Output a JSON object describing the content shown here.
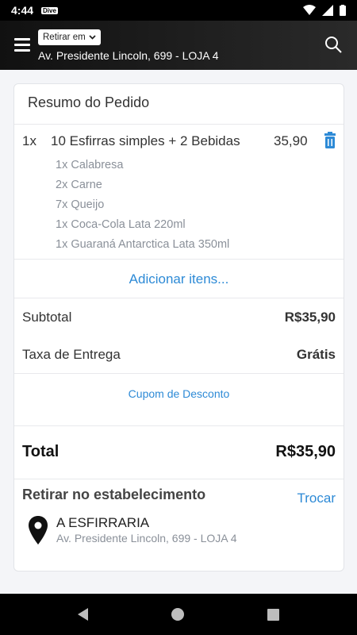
{
  "status_bar": {
    "time": "4:44",
    "app_badge": "Dive"
  },
  "header": {
    "pickup_mode": "Retirar em",
    "address": "Av. Presidente Lincoln, 699 - LOJA 4",
    "icons": {
      "menu": "menu-icon",
      "search": "search-icon"
    }
  },
  "summary": {
    "title": "Resumo do Pedido",
    "item": {
      "qty": "1x",
      "name": "10 Esfirras simples + 2 Bebidas",
      "price": "35,90",
      "sub_items": [
        "1x Calabresa",
        "2x Carne",
        "7x Queijo",
        "1x Coca-Cola Lata 220ml",
        "1x Guaraná Antarctica Lata 350ml"
      ]
    },
    "add_items": "Adicionar itens...",
    "subtotal_label": "Subtotal",
    "subtotal_value": "R$35,90",
    "delivery_label": "Taxa de Entrega",
    "delivery_value": "Grátis",
    "coupon": "Cupom de Desconto",
    "total_label": "Total",
    "total_value": "R$35,90"
  },
  "pickup": {
    "title": "Retirar no estabelecimento",
    "change": "Trocar",
    "store_name": "A ESFIRRARIA",
    "store_address": "Av. Presidente Lincoln, 699 - LOJA 4"
  },
  "colors": {
    "accent": "#2d8ad6",
    "header_bg": "#1a1a1a",
    "muted": "#8a9099"
  }
}
